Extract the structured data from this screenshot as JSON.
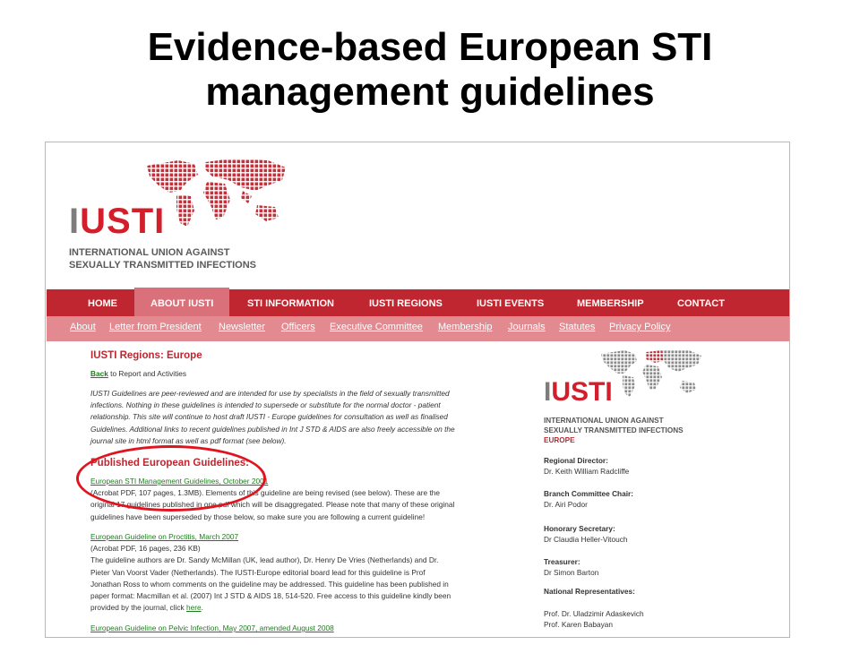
{
  "slide": {
    "title_line1": "Evidence-based European STI",
    "title_line2": "management guidelines"
  },
  "header": {
    "logo_brand": "IUSTI",
    "logo_sub_line1": "INTERNATIONAL UNION AGAINST",
    "logo_sub_line2": "SEXUALLY TRANSMITTED INFECTIONS"
  },
  "nav": {
    "items": [
      "HOME",
      "ABOUT IUSTI",
      "STI INFORMATION",
      "IUSTI REGIONS",
      "IUSTI EVENTS",
      "MEMBERSHIP",
      "CONTACT"
    ],
    "active": "ABOUT IUSTI"
  },
  "subnav": {
    "items": [
      "About",
      "Letter from President",
      "Newsletter",
      "Officers",
      "Executive Committee",
      "Membership",
      "Journals",
      "Statutes",
      "Privacy Policy"
    ]
  },
  "content": {
    "page_title": "IUSTI Regions: Europe",
    "back_link": "Back",
    "back_suffix": " to Report and Activities",
    "intro_l1": "IUSTI Guidelines are peer-reviewed and are intended for use by specialists in the field of sexually transmitted",
    "intro_l2": "infections. Nothing in these guidelines is intended to supersede or substitute for the normal doctor - patient",
    "intro_l3": "relationship. This site will continue to host draft IUSTI - Europe guidelines for consultation as well as finalised",
    "intro_l4": "Guidelines. Additional links to recent guidelines published in Int J STD & AIDS are also freely accessible on the",
    "intro_l5": "journal site in html format as well as pdf format  (see below).",
    "section_title": "Published European Guidelines:",
    "g1_link": "European STI Management Guidelines, October 2001",
    "g1_l1": "(Acrobat PDF, 107 pages, 1.3MB). Elements of this guideline are being revised (see below). These are the",
    "g1_l2": "original 17 guidelines published in one pdf which will be disaggregated. Please note that many of these original",
    "g1_l3": "guidelines have been superseded by those below, so make sure you are following a current guideline!",
    "g2_link": "European Guideline on Proctitis, March 2007",
    "g2_meta": "(Acrobat PDF, 16 pages, 236 KB)",
    "g2_l1": "The guideline authors are Dr. Sandy McMillan (UK, lead author), Dr. Henry De Vries (Netherlands) and Dr.",
    "g2_l2": "Pieter Van Voorst Vader (Netherlands). The IUSTI-Europe editorial board lead for this guideline is Prof",
    "g2_l3": "Jonathan Ross to whom comments on the guideline may be addressed. This guideline has been published in",
    "g2_l4": "paper format:  Macmillan et al. (2007) Int J STD & AIDS 18, 514-520. Free access to this guideline kindly been",
    "g2_l5": "provided by the journal, click",
    "g2_here": "here",
    "g3_link": "European Guideline on Pelvic Infection, May 2007, amended August 2008"
  },
  "sidebar": {
    "brand": "IUSTI",
    "sub_line1": "INTERNATIONAL UNION AGAINST",
    "sub_line2": "SEXUALLY TRANSMITTED INFECTIONS",
    "region": "EUROPE",
    "regional_director_label": "Regional Director:",
    "regional_director": "Dr. Keith William Radcliffe",
    "branch_chair_label": "Branch Committee Chair:",
    "branch_chair": "Dr. Airi Podor",
    "hon_secretary_label": "Honorary Secretary:",
    "hon_secretary": "Dr Claudia Heller-Vitouch",
    "treasurer_label": "Treasurer:",
    "treasurer": "Dr Simon Barton",
    "national_reps_label": "National Representatives:",
    "national_reps": [
      "Prof. Dr. Uladzimir Adaskevich",
      "Prof. Karen Babayan"
    ]
  },
  "colors": {
    "brand_red": "#c0262f",
    "subnav_pink": "#e38a91",
    "link_green": "#1c7d1c",
    "annotation_red": "#e0141e"
  }
}
